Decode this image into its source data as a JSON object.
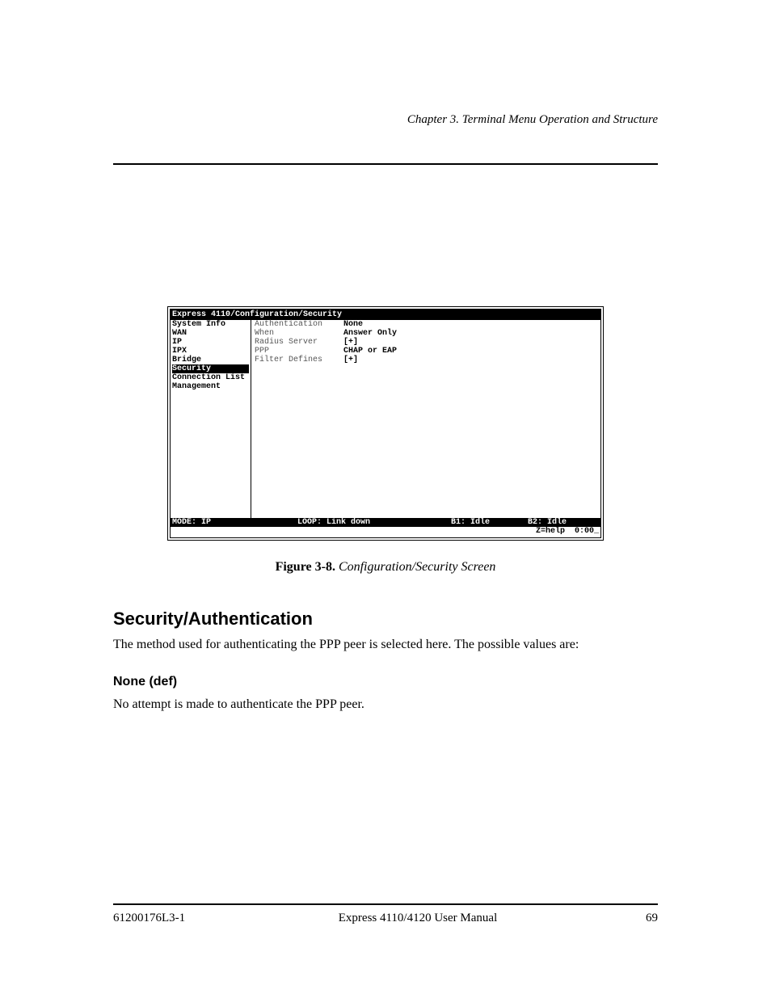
{
  "header": {
    "chapter": "Chapter 3. Terminal Menu Operation and Structure"
  },
  "screenshot": {
    "title": "Express 4110/Configuration/Security",
    "sidebar": {
      "items": [
        "System Info",
        "WAN",
        "IP",
        "IPX",
        "Bridge",
        "Security",
        "Connection List",
        "Management"
      ],
      "selectedIndex": 5
    },
    "fields": [
      {
        "label": "Authentication",
        "value": "None"
      },
      {
        "label": "When",
        "value": "Answer Only"
      },
      {
        "label": "Radius Server",
        "value": "[+]"
      },
      {
        "label": "PPP",
        "value": "CHAP or EAP"
      },
      {
        "label": "Filter Defines",
        "value": "[+]"
      }
    ],
    "status": {
      "mode": "MODE: IP",
      "loop": "LOOP: Link down",
      "b1": "B1: Idle",
      "b2": "B2: Idle"
    },
    "helpbar": "Z=help  0:00_"
  },
  "figure": {
    "label": "Figure 3-8. ",
    "title": "Configuration/Security Screen"
  },
  "section": {
    "heading": "Security/Authentication",
    "body": "The method used for authenticating the PPP peer is selected here. The possible values are:",
    "subhead": "None (def)",
    "subbody": "No attempt is made to authenticate the PPP peer."
  },
  "footer": {
    "text": "Express 4110/4120 User Manual",
    "docnum": "61200176L3-1",
    "page": "69"
  }
}
